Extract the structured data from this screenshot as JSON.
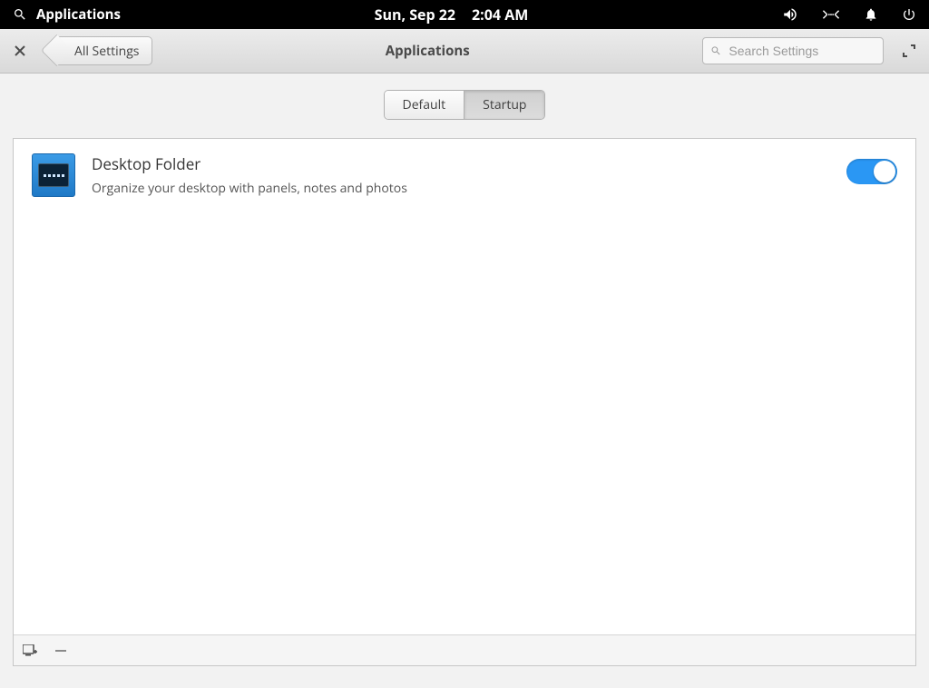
{
  "panel": {
    "applications_label": "Applications",
    "date": "Sun, Sep 22",
    "time": "2:04 AM"
  },
  "window": {
    "back_label": "All Settings",
    "title": "Applications",
    "search_placeholder": "Search Settings"
  },
  "tabs": {
    "default": "Default",
    "startup": "Startup",
    "active": "startup"
  },
  "startup_apps": [
    {
      "title": "Desktop Folder",
      "description": "Organize your desktop with panels, notes and photos",
      "enabled": true
    }
  ],
  "colors": {
    "accent": "#2a97f4"
  }
}
